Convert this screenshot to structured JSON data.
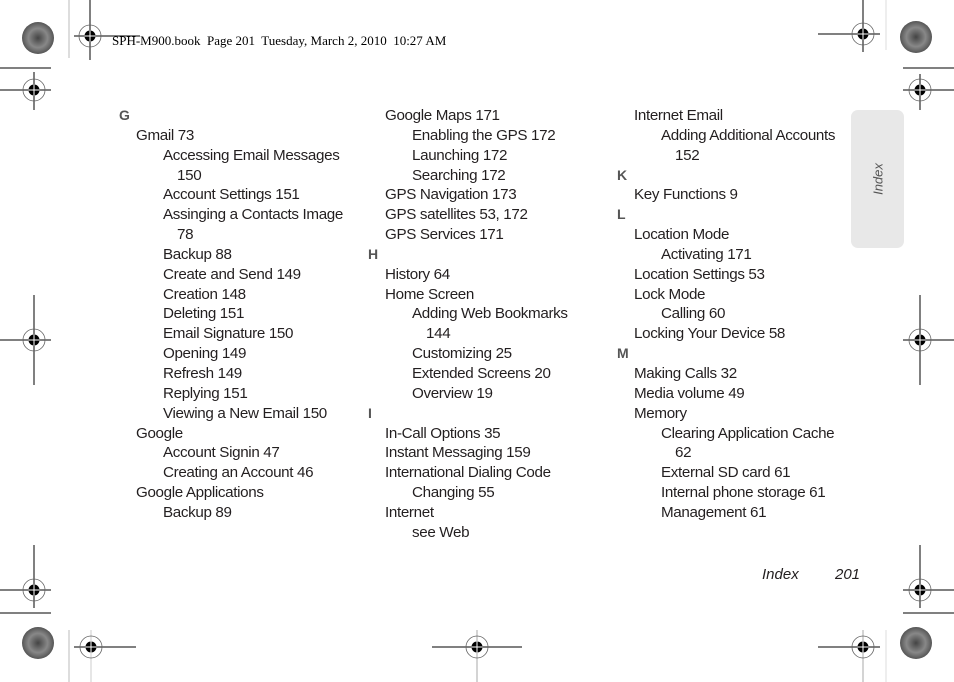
{
  "header": {
    "file_info": "SPH-M900.book  Page 201  Tuesday, March 2, 2010  10:27 AM"
  },
  "side_tab": {
    "label": "Index"
  },
  "footer": {
    "section": "Index",
    "page_number": "201"
  },
  "columns": [
    {
      "rows": [
        {
          "type": "letter",
          "text": "G"
        },
        {
          "type": "l1",
          "text": "Gmail 73"
        },
        {
          "type": "l2",
          "text": "Accessing Email Messages"
        },
        {
          "type": "l2c",
          "text": "150"
        },
        {
          "type": "l2",
          "text": "Account Settings 151"
        },
        {
          "type": "l2",
          "text": "Assinging a Contacts Image"
        },
        {
          "type": "l2c",
          "text": "78"
        },
        {
          "type": "l2",
          "text": "Backup 88"
        },
        {
          "type": "l2",
          "text": "Create and Send 149"
        },
        {
          "type": "l2",
          "text": "Creation 148"
        },
        {
          "type": "l2",
          "text": "Deleting 151"
        },
        {
          "type": "l2",
          "text": "Email Signature 150"
        },
        {
          "type": "l2",
          "text": "Opening 149"
        },
        {
          "type": "l2",
          "text": "Refresh 149"
        },
        {
          "type": "l2",
          "text": "Replying 151"
        },
        {
          "type": "l2",
          "text": "Viewing a New Email 150"
        },
        {
          "type": "l1",
          "text": "Google"
        },
        {
          "type": "l2",
          "text": "Account Signin 47"
        },
        {
          "type": "l2",
          "text": "Creating an Account 46"
        },
        {
          "type": "l1",
          "text": "Google Applications"
        },
        {
          "type": "l2",
          "text": "Backup 89"
        }
      ]
    },
    {
      "rows": [
        {
          "type": "l1",
          "text": "Google Maps 171"
        },
        {
          "type": "l2",
          "text": "Enabling the GPS 172"
        },
        {
          "type": "l2",
          "text": "Launching 172"
        },
        {
          "type": "l2",
          "text": "Searching 172"
        },
        {
          "type": "l1",
          "text": "GPS Navigation 173"
        },
        {
          "type": "l1",
          "text": "GPS satellites 53, 172"
        },
        {
          "type": "l1",
          "text": "GPS Services 171"
        },
        {
          "type": "letter",
          "text": "H"
        },
        {
          "type": "l1",
          "text": "History 64"
        },
        {
          "type": "l1",
          "text": "Home Screen"
        },
        {
          "type": "l2",
          "text": "Adding Web Bookmarks"
        },
        {
          "type": "l2c",
          "text": "144"
        },
        {
          "type": "l2",
          "text": "Customizing 25"
        },
        {
          "type": "l2",
          "text": "Extended Screens 20"
        },
        {
          "type": "l2",
          "text": "Overview 19"
        },
        {
          "type": "letter",
          "text": "I"
        },
        {
          "type": "l1",
          "text": "In-Call Options 35"
        },
        {
          "type": "l1",
          "text": "Instant Messaging 159"
        },
        {
          "type": "l1",
          "text": "International Dialing Code"
        },
        {
          "type": "l2",
          "text": "Changing 55"
        },
        {
          "type": "l1",
          "text": "Internet"
        },
        {
          "type": "l2",
          "text": "see Web"
        }
      ]
    },
    {
      "rows": [
        {
          "type": "l1",
          "text": "Internet Email"
        },
        {
          "type": "l2",
          "text": "Adding Additional Accounts"
        },
        {
          "type": "l2c",
          "text": "152"
        },
        {
          "type": "letter",
          "text": "K"
        },
        {
          "type": "l1",
          "text": "Key Functions 9"
        },
        {
          "type": "letter",
          "text": "L"
        },
        {
          "type": "l1",
          "text": "Location Mode"
        },
        {
          "type": "l2",
          "text": "Activating 171"
        },
        {
          "type": "l1",
          "text": "Location Settings 53"
        },
        {
          "type": "l1",
          "text": "Lock Mode"
        },
        {
          "type": "l2",
          "text": "Calling 60"
        },
        {
          "type": "l1",
          "text": "Locking Your Device 58"
        },
        {
          "type": "letter",
          "text": "M"
        },
        {
          "type": "l1",
          "text": "Making Calls 32"
        },
        {
          "type": "l1",
          "text": "Media volume 49"
        },
        {
          "type": "l1",
          "text": "Memory"
        },
        {
          "type": "l2",
          "text": "Clearing Application Cache"
        },
        {
          "type": "l2c",
          "text": "62"
        },
        {
          "type": "l2",
          "text": "External SD card 61"
        },
        {
          "type": "l2",
          "text": "Internal phone storage 61"
        },
        {
          "type": "l2",
          "text": "Management 61"
        }
      ]
    }
  ]
}
